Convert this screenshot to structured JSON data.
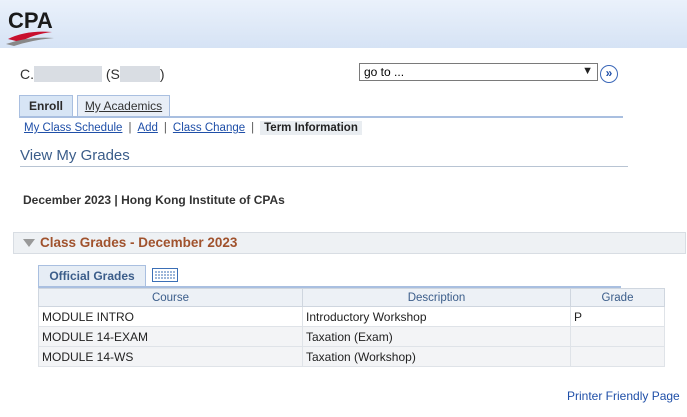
{
  "header": {
    "logo_text": "CPA"
  },
  "student": {
    "name_prefix": "C.",
    "name_mid": " (S",
    "name_suffix": ")"
  },
  "goto": {
    "value": "go to ...",
    "button_glyph": "»"
  },
  "tabs": [
    {
      "label": "Enroll",
      "active": true
    },
    {
      "label": "My Academics",
      "active": false
    }
  ],
  "subnav": {
    "items": [
      "My Class Schedule",
      "Add",
      "Class Change"
    ],
    "current": "Term Information",
    "separator": "|"
  },
  "page": {
    "title": "View My Grades",
    "term_line": "December 2023 | Hong Kong Institute of CPAs"
  },
  "section": {
    "title": "Class Grades - December 2023"
  },
  "grid": {
    "tab_label": "Official Grades",
    "columns": [
      "Course",
      "Description",
      "Grade"
    ],
    "rows": [
      {
        "course": "MODULE INTRO",
        "description": "Introductory Workshop",
        "grade": "P"
      },
      {
        "course": "MODULE 14-EXAM",
        "description": "Taxation (Exam)",
        "grade": ""
      },
      {
        "course": "MODULE 14-WS",
        "description": "Taxation (Workshop)",
        "grade": ""
      }
    ]
  },
  "footer": {
    "printer_link": "Printer Friendly Page"
  },
  "colors": {
    "link": "#1f4fa8",
    "section_title": "#a0522d",
    "banner": "#d6e3f5"
  }
}
